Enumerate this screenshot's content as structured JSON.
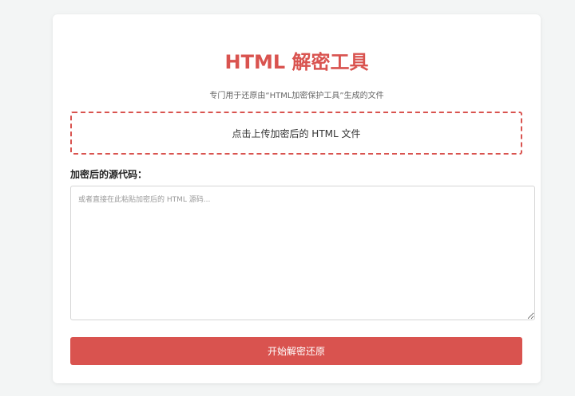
{
  "header": {
    "title": "HTML 解密工具",
    "subtitle": "专门用于还原由“HTML加密保护工具”生成的文件"
  },
  "upload": {
    "label": "点击上传加密后的 HTML 文件"
  },
  "source": {
    "label": "加密后的源代码：",
    "placeholder": "或者直接在此粘贴加密后的 HTML 源码...",
    "value": ""
  },
  "actions": {
    "decrypt_label": "开始解密还原"
  },
  "colors": {
    "accent": "#d9534f",
    "background": "#f3f5f5",
    "card": "#ffffff"
  }
}
